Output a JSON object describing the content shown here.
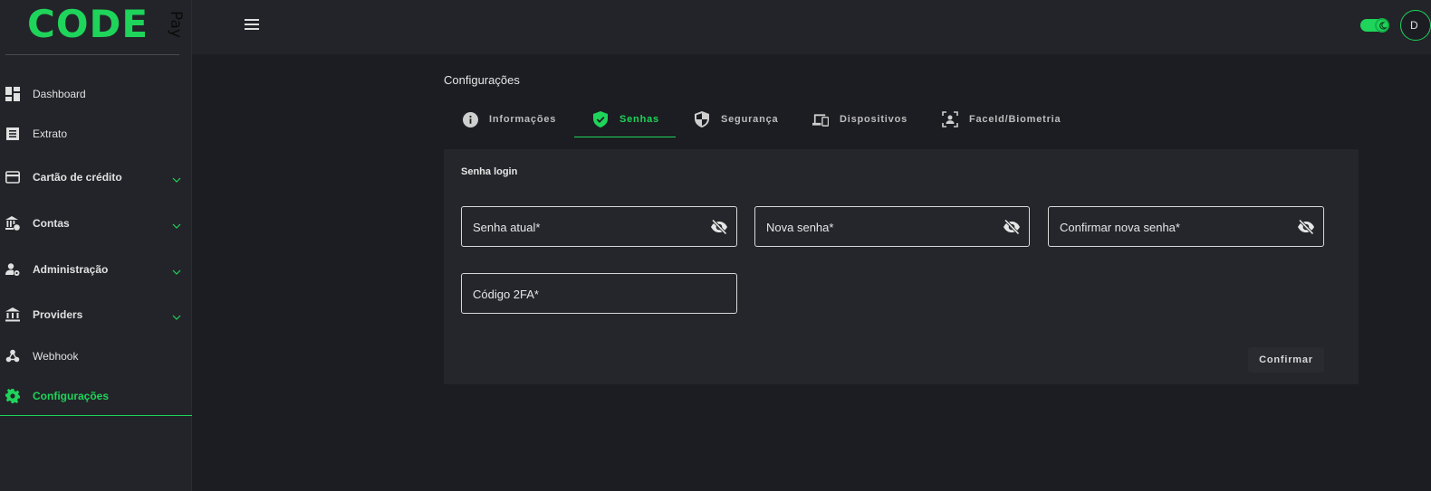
{
  "logo": {
    "main": "CODE",
    "sub": "Pay"
  },
  "sidebar": {
    "items": [
      {
        "label": "Dashboard",
        "icon": "dashboard-icon"
      },
      {
        "label": "Extrato",
        "icon": "receipt-icon"
      },
      {
        "label": "Cartão de crédito",
        "icon": "credit-card-icon"
      },
      {
        "label": "Contas",
        "icon": "bank-verified-icon"
      },
      {
        "label": "Administração",
        "icon": "user-gear-icon"
      },
      {
        "label": "Providers",
        "icon": "bank-icon"
      },
      {
        "label": "Webhook",
        "icon": "webhook-icon"
      },
      {
        "label": "Configurações",
        "icon": "gear-icon"
      }
    ]
  },
  "header": {
    "avatar_initial": "D",
    "theme_toggle": "on"
  },
  "main": {
    "title": "Configurações",
    "tabs": [
      {
        "label": "Informações",
        "icon": "info-icon"
      },
      {
        "label": "Senhas",
        "icon": "shield-check-icon"
      },
      {
        "label": "Segurança",
        "icon": "shield-icon"
      },
      {
        "label": "Dispositivos",
        "icon": "devices-icon"
      },
      {
        "label": "FaceId/Biometria",
        "icon": "face-id-icon"
      }
    ],
    "active_tab": "Senhas",
    "card": {
      "title": "Senha login",
      "fields": {
        "current_password": "Senha atual*",
        "new_password": "Nova senha*",
        "confirm_password": "Confirmar nova senha*",
        "code_2fa": "Código 2FA*"
      },
      "confirm_label": "Confirmar"
    }
  },
  "colors": {
    "accent": "#1ed45a",
    "background": "#1c1d22",
    "panel": "#232429",
    "card": "#25262c"
  }
}
